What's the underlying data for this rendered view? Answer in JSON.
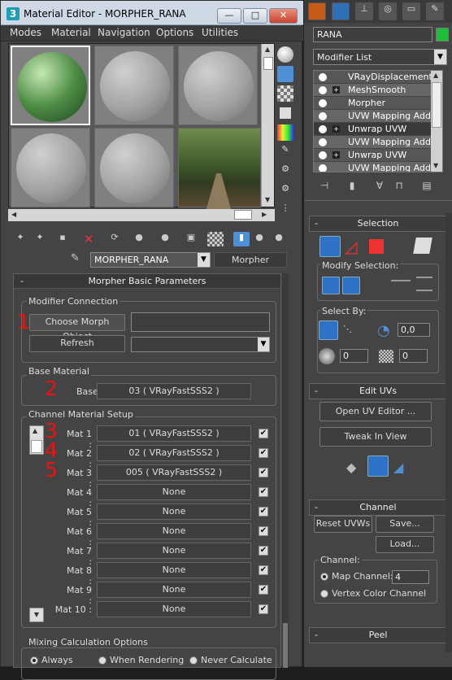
{
  "window": {
    "title": "Material Editor - MORPHER_RANA",
    "minimize": "—",
    "maximize": "□",
    "close": "✕"
  },
  "menu": [
    "Modes",
    "Material",
    "Navigation",
    "Options",
    "Utilities"
  ],
  "material_name": "MORPHER_RANA",
  "material_type": "Morpher",
  "rollout_title": "Morpher Basic Parameters",
  "modifier_connection": {
    "group_label": "Modifier Connection",
    "choose_button": "Choose Morph Object",
    "refresh_button": "Refresh",
    "annotation": "1"
  },
  "base_material": {
    "group_label": "Base Material",
    "label": "Base :",
    "value": "03  ( VRayFastSSS2 )",
    "annotation": "2"
  },
  "channel_setup": {
    "group_label": "Channel Material Setup",
    "rows": [
      {
        "label": "Mat 1 :",
        "value": "01  ( VRayFastSSS2 )",
        "annotation": "3"
      },
      {
        "label": "Mat 2 :",
        "value": "02  ( VRayFastSSS2 )",
        "annotation": "4"
      },
      {
        "label": "Mat 3 :",
        "value": "005  ( VRayFastSSS2 )",
        "annotation": "5"
      },
      {
        "label": "Mat 4 :",
        "value": "None",
        "annotation": ""
      },
      {
        "label": "Mat 5 :",
        "value": "None",
        "annotation": ""
      },
      {
        "label": "Mat 6 :",
        "value": "None",
        "annotation": ""
      },
      {
        "label": "Mat 7 :",
        "value": "None",
        "annotation": ""
      },
      {
        "label": "Mat 8 :",
        "value": "None",
        "annotation": ""
      },
      {
        "label": "Mat 9 :",
        "value": "None",
        "annotation": ""
      },
      {
        "label": "Mat 10 :",
        "value": "None",
        "annotation": ""
      }
    ]
  },
  "mixing": {
    "group_label": "Mixing Calculation Options",
    "options": [
      "Always",
      "When Rendering",
      "Never Calculate"
    ]
  },
  "command_panel": {
    "object_name": "RANA",
    "object_color": "#1fbf3b",
    "modifier_list": "Modifier List",
    "stack": [
      {
        "name": "VRayDisplacementMo",
        "plus": false
      },
      {
        "name": "MeshSmooth",
        "plus": true
      },
      {
        "name": "Morpher",
        "plus": false
      },
      {
        "name": "UVW Mapping Add",
        "plus": false
      },
      {
        "name": "Unwrap UVW",
        "plus": true
      },
      {
        "name": "UVW Mapping Add",
        "plus": false
      },
      {
        "name": "Unwrap UVW",
        "plus": true
      },
      {
        "name": "UVW Mapping Add",
        "plus": false
      }
    ],
    "selection": {
      "title": "Selection",
      "modify_label": "Modify Selection:",
      "select_by_label": "Select By:",
      "angle_value": "0,0",
      "spin1": "0",
      "spin2": "0"
    },
    "edit_uvs": {
      "title": "Edit UVs",
      "open_button": "Open UV Editor ...",
      "tweak_button": "Tweak In View"
    },
    "channel": {
      "title": "Channel",
      "reset_button": "Reset UVWs",
      "save_button": "Save...",
      "load_button": "Load...",
      "group_label": "Channel:",
      "map_channel_label": "Map Channel:",
      "map_channel_value": "4",
      "vertex_color_label": "Vertex Color Channel"
    },
    "peel": {
      "title": "Peel"
    }
  }
}
